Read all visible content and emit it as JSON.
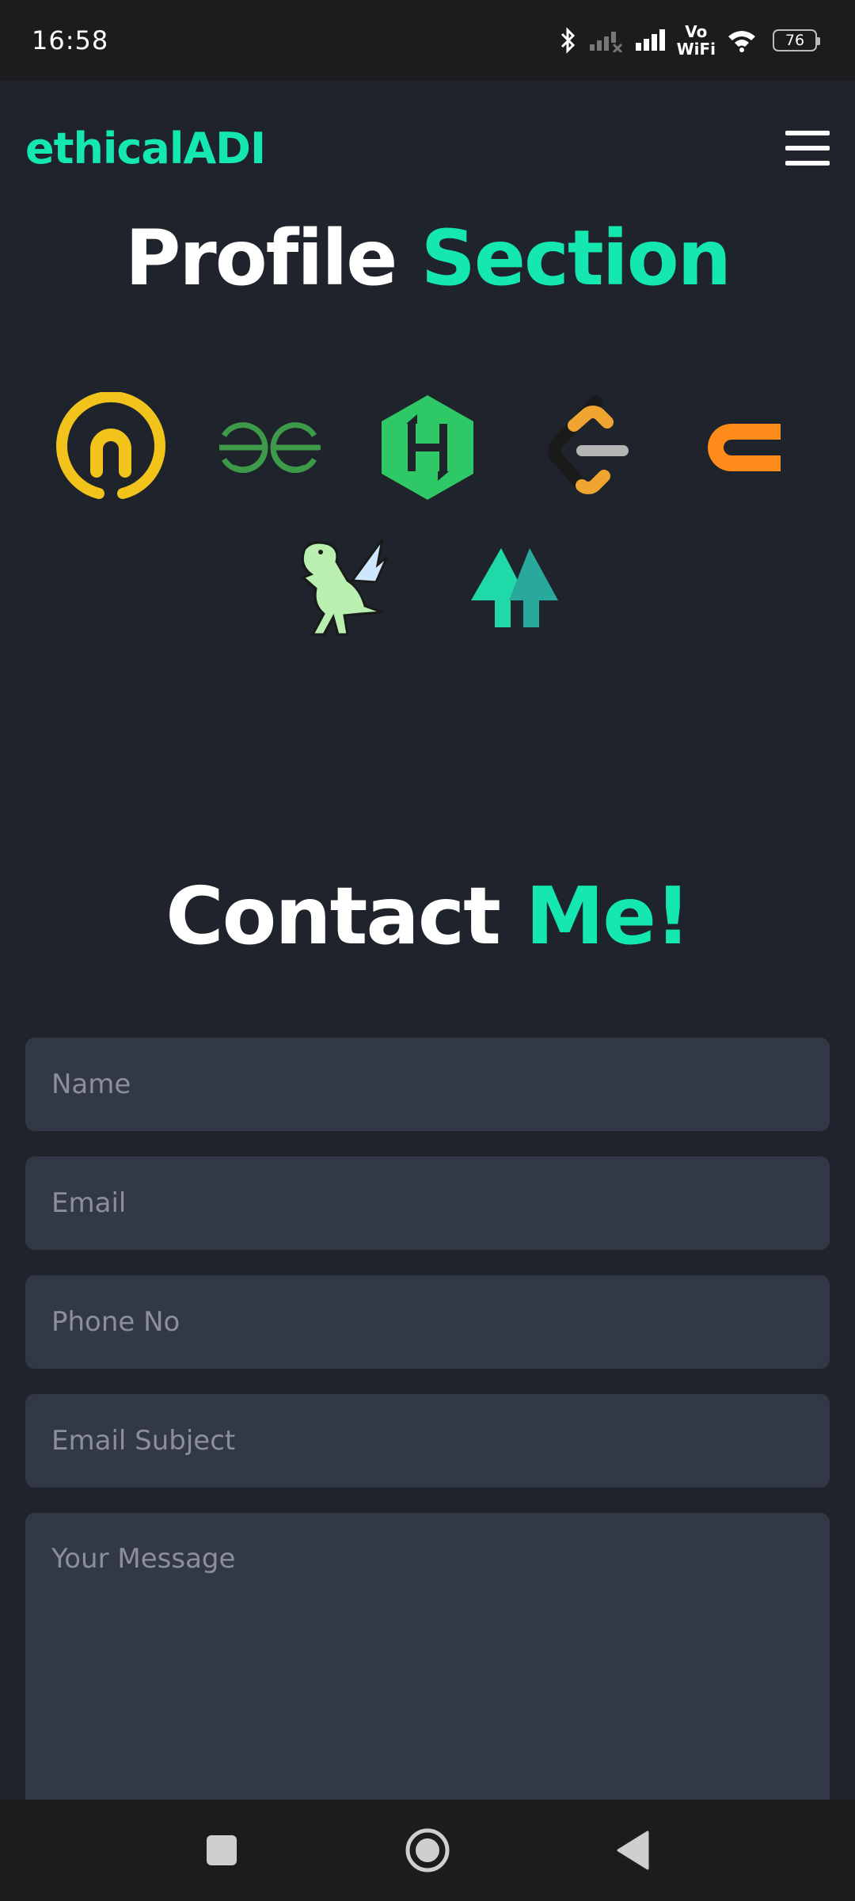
{
  "status_bar": {
    "time": "16:58",
    "volte_line1": "Vo",
    "volte_line2": "WiFi",
    "battery": "76",
    "icons": [
      "bluetooth-icon",
      "signal-no-service-icon",
      "signal-icon",
      "wifi-icon",
      "battery-icon"
    ]
  },
  "header": {
    "logo": "ethicalADI",
    "menu_icon": "hamburger-menu-icon"
  },
  "profile": {
    "title_part1": "Profile",
    "title_part2": "Section",
    "icons": [
      {
        "name": "codechef-like-icon",
        "color": "#f2c31b"
      },
      {
        "name": "geeksforgeeks-icon",
        "color": "#3c9a48"
      },
      {
        "name": "hackerrank-icon",
        "color": "#2ec866"
      },
      {
        "name": "leetcode-icon",
        "color": "#f0a531"
      },
      {
        "name": "codeforces-like-icon",
        "color": "#ff8c1a"
      },
      {
        "name": "dinosaur-dragon-icon",
        "color": "#b9f0b0"
      },
      {
        "name": "double-up-arrow-icon",
        "color": "#20c9a0"
      }
    ]
  },
  "contact": {
    "title_part1": "Contact",
    "title_part2": "Me!",
    "fields": {
      "name_placeholder": "Name",
      "email_placeholder": "Email",
      "phone_placeholder": "Phone No",
      "subject_placeholder": "Email Subject",
      "message_placeholder": "Your Message"
    }
  },
  "nav": {
    "icons": [
      "recent-apps-square-icon",
      "home-circle-icon",
      "back-triangle-icon"
    ]
  },
  "colors": {
    "background": "#1f232b",
    "accent": "#14e8b0",
    "field_bg": "#323845",
    "bar_bg": "#1c1c1e"
  }
}
